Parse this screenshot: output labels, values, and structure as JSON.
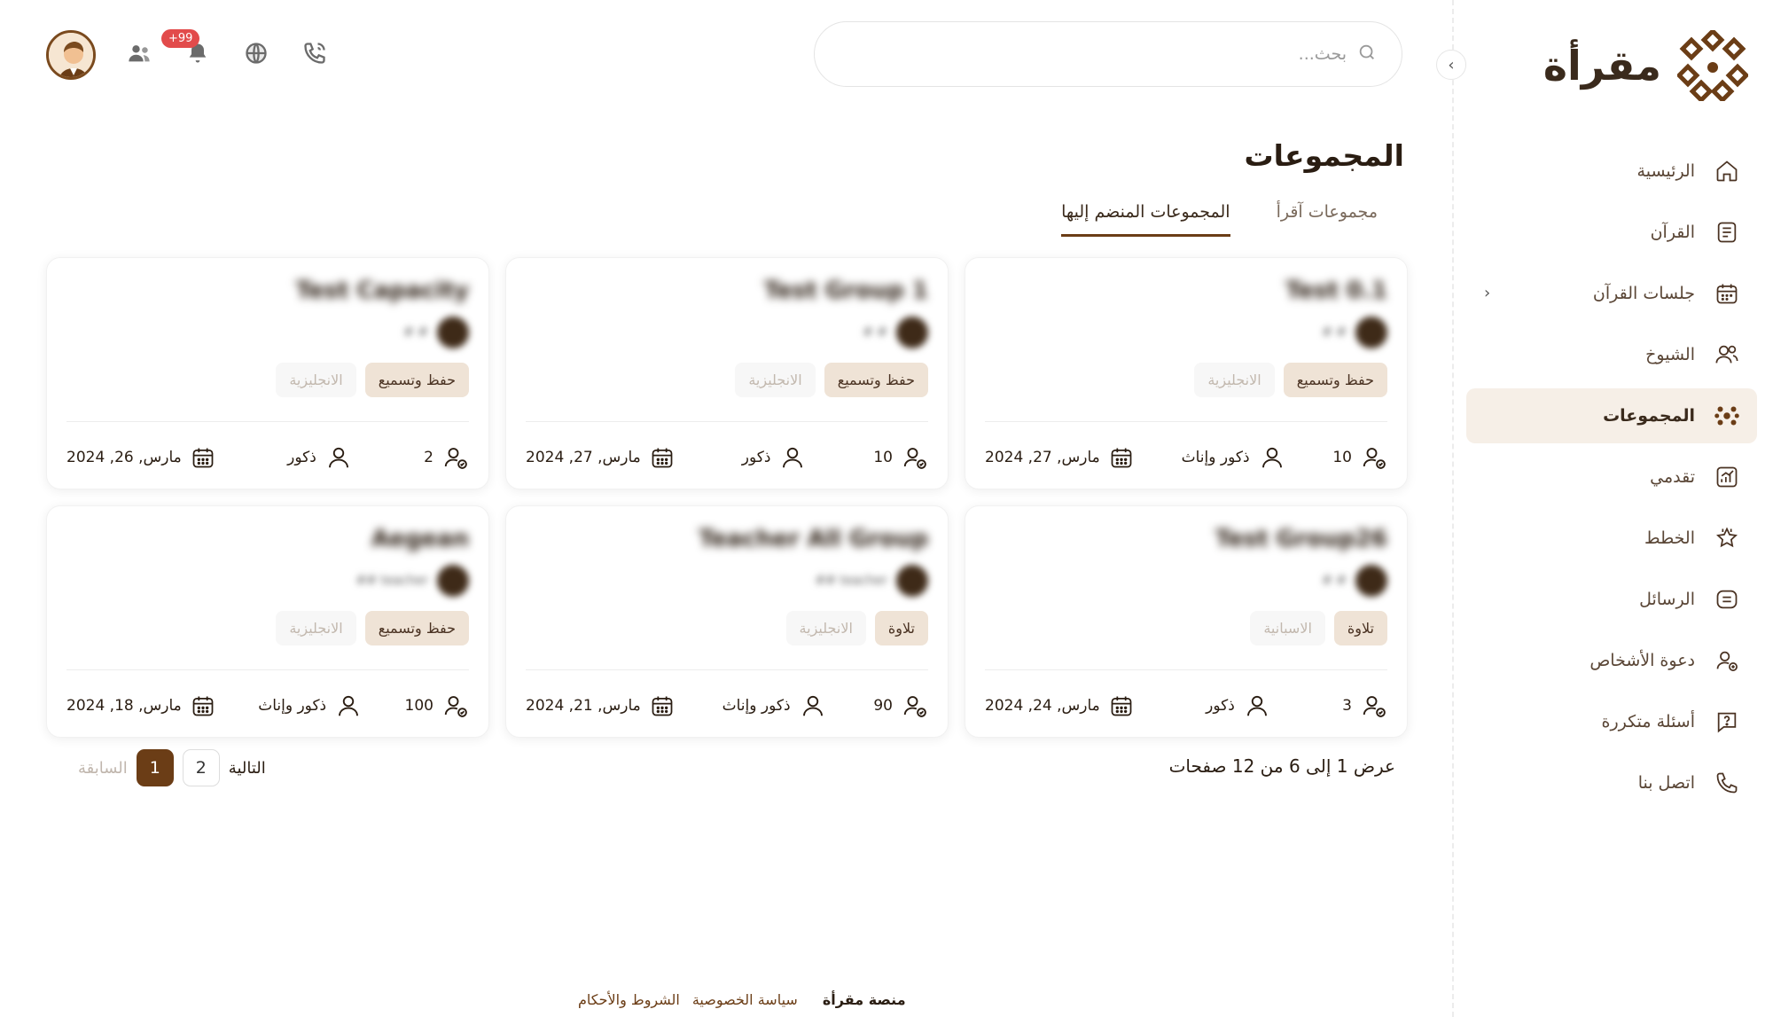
{
  "app": {
    "logo_text": "مقرأة"
  },
  "sidebar": {
    "items": [
      {
        "label": "الرئيسية",
        "icon": "home-icon"
      },
      {
        "label": "القرآن",
        "icon": "book-icon"
      },
      {
        "label": "جلسات القرآن",
        "icon": "calendar-icon"
      },
      {
        "label": "الشيوخ",
        "icon": "users-icon"
      },
      {
        "label": "المجموعات",
        "icon": "groups-icon"
      },
      {
        "label": "تقدمي",
        "icon": "chart-icon"
      },
      {
        "label": "الخطط",
        "icon": "star-badge-icon"
      },
      {
        "label": "الرسائل",
        "icon": "message-icon"
      },
      {
        "label": "دعوة الأشخاص",
        "icon": "user-add-icon"
      },
      {
        "label": "أسئلة متكررة",
        "icon": "question-icon"
      },
      {
        "label": "اتصل بنا",
        "icon": "phone-icon"
      }
    ]
  },
  "header": {
    "search_placeholder": "بحث...",
    "notifications_badge": "+99"
  },
  "main": {
    "title": "المجموعات",
    "tabs": [
      {
        "label": "مجموعات آقرأ"
      },
      {
        "label": "المجموعات المنضم إليها"
      }
    ],
    "cards": [
      {
        "title": "Test 0.1",
        "teacher": "# #",
        "chip1": "حفظ وتسميع",
        "chip2": "الانجليزية",
        "count": "10",
        "gender": "ذكور وإناث",
        "date": "مارس, 27, 2024"
      },
      {
        "title": "Test Group 1",
        "teacher": "# #",
        "chip1": "حفظ وتسميع",
        "chip2": "الانجليزية",
        "count": "10",
        "gender": "ذكور",
        "date": "مارس, 27, 2024"
      },
      {
        "title": "Test Capacity",
        "teacher": "# #",
        "chip1": "حفظ وتسميع",
        "chip2": "الانجليزية",
        "count": "2",
        "gender": "ذكور",
        "date": "مارس, 26, 2024"
      },
      {
        "title": "Test Group26",
        "teacher": "# #",
        "chip1": "تلاوة",
        "chip2": "الاسبانية",
        "count": "3",
        "gender": "ذكور",
        "date": "مارس, 24, 2024"
      },
      {
        "title": "Teacher All Group",
        "teacher": "teacher ##",
        "chip1": "تلاوة",
        "chip2": "الانجليزية",
        "count": "90",
        "gender": "ذكور وإناث",
        "date": "مارس, 21, 2024"
      },
      {
        "title": "Aegean",
        "teacher": "teacher ##",
        "chip1": "حفظ وتسميع",
        "chip2": "الانجليزية",
        "count": "100",
        "gender": "ذكور وإناث",
        "date": "مارس, 18, 2024"
      }
    ],
    "results_text": "عرض 1 إلى 6 من 12 صفحات",
    "pagination": {
      "prev": "السابقة",
      "next": "التالية",
      "pages": [
        "1",
        "2"
      ]
    }
  },
  "footer": {
    "brand": "منصة مقرأة",
    "privacy": "سياسة الخصوصية",
    "terms": "الشروط والأحكام"
  },
  "colors": {
    "accent": "#6b3d16",
    "active_bg": "#f6efe7",
    "badge": "#e24b4b"
  }
}
